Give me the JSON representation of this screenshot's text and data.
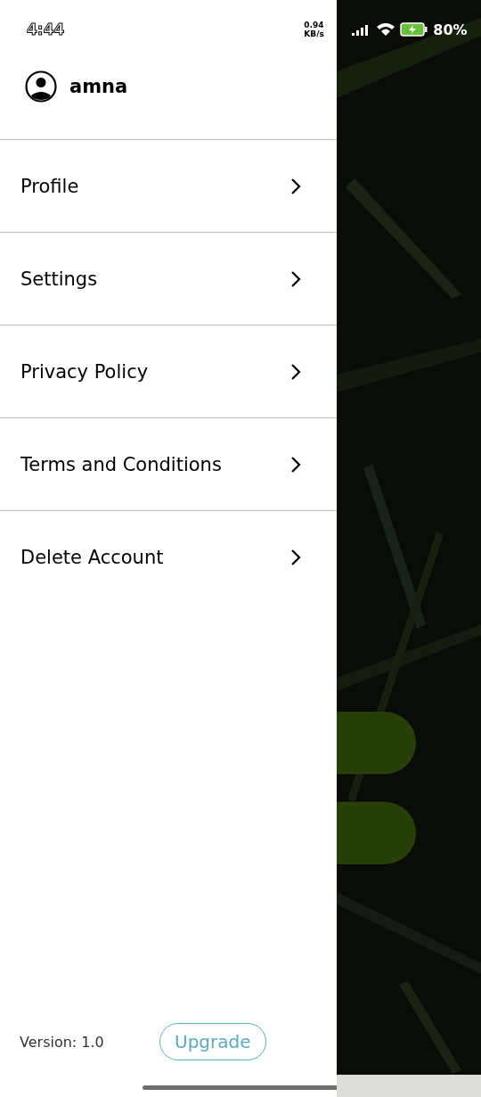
{
  "status_bar": {
    "time": "4:44",
    "net_speed": "0.94 KB/s",
    "battery": "80%"
  },
  "user": {
    "name": "amna"
  },
  "menu": [
    {
      "label": "Profile",
      "divider": true
    },
    {
      "label": "Settings",
      "divider": true
    },
    {
      "label": "Privacy Policy",
      "divider": true
    },
    {
      "label": "Terms and Conditions",
      "divider": true
    },
    {
      "label": "Delete Account",
      "divider": false
    }
  ],
  "footer": {
    "version": "Version: 1.0",
    "button": "Upgrade"
  }
}
